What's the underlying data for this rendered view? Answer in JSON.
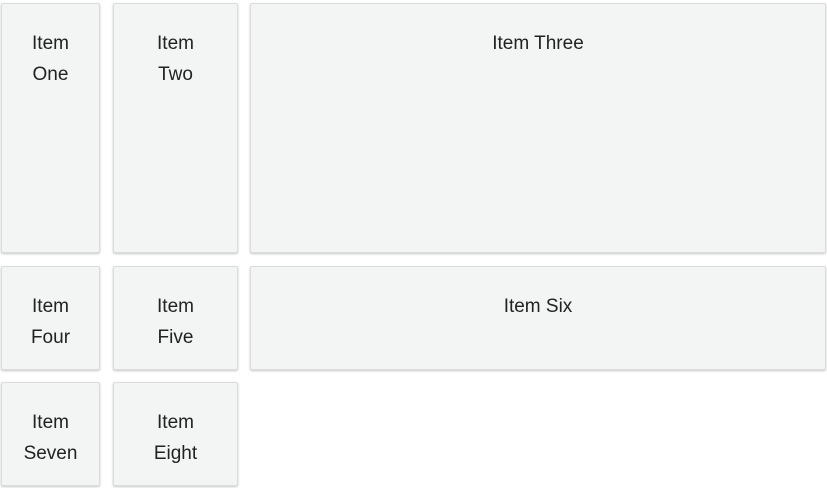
{
  "grid": {
    "items": [
      {
        "label": "Item One"
      },
      {
        "label": "Item Two"
      },
      {
        "label": "Item Three"
      },
      {
        "label": "Item Four"
      },
      {
        "label": "Item Five"
      },
      {
        "label": "Item Six"
      },
      {
        "label": "Item Seven"
      },
      {
        "label": "Item Eight"
      }
    ]
  },
  "colors": {
    "card_background": "#f3f4f4",
    "card_border": "#dcdcdc",
    "text": "#222222"
  }
}
